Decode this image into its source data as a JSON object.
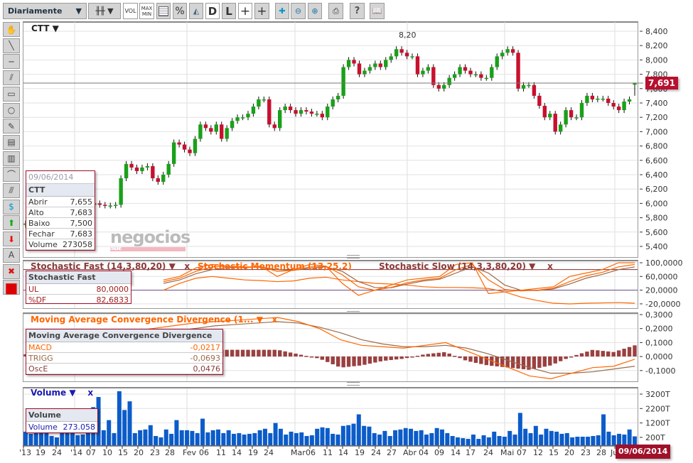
{
  "toolbar": {
    "period": "Diariamente",
    "vol": "VOL",
    "max": "MAX",
    "min": "MIN",
    "pct": "%",
    "d": "D",
    "l": "L",
    "help": "?"
  },
  "tools": [
    "hand-icon",
    "line-icon",
    "horizontal-line-icon",
    "channel-icon",
    "rectangle-icon",
    "circle-icon",
    "pencil-icon",
    "fibonacci-icon",
    "fibonacci-fan-icon",
    "arc-icon",
    "parallel-lines-icon",
    "dollar-lines-icon",
    "up-arrow-icon",
    "down-arrow-icon",
    "text-icon",
    "delete-icon",
    "color-icon"
  ],
  "text_tool": "A",
  "colors": {
    "up": "#1aa01a",
    "down": "#c8102e",
    "accent": "#a0102a",
    "orange": "#ff6600",
    "brown": "#9a6a4a",
    "volume": "#0b5cc9"
  },
  "main": {
    "symbol": "CTT",
    "high_label": "8,20",
    "last_price": "7,691",
    "watermark": "negocios",
    "watermark_sub": "ONLINE",
    "price_ticks": [
      "8,400",
      "8,200",
      "8,000",
      "7,800",
      "7,600",
      "7,400",
      "7,200",
      "7,000",
      "6,800",
      "6,600",
      "6,400",
      "6,200",
      "6,000",
      "5,800",
      "5,600",
      "5,400"
    ],
    "info": {
      "date": "09/06/2014",
      "symbol": "CTT",
      "rows": [
        {
          "k": "Abrir",
          "v": "7,655"
        },
        {
          "k": "Alto",
          "v": "7,683"
        },
        {
          "k": "Baixo",
          "v": "7,500"
        },
        {
          "k": "Fechar",
          "v": "7,683"
        },
        {
          "k": "Volume",
          "v": "273058"
        }
      ]
    }
  },
  "stoch": {
    "t1": "Stochastic Fast (14,3,80,20)",
    "t2": "Stochastic Momentum (13,25,2)",
    "t3": "Stochastic Slow (14,3,3,80,20)",
    "x": "x",
    "ticks": [
      "100,0000",
      "60,0000",
      "20,0000",
      "-20,0000"
    ],
    "info": {
      "title": "Stochastic Fast",
      "rows": [
        {
          "k": "UL",
          "v": "80,0000"
        },
        {
          "k": "%DF",
          "v": "82,6833"
        }
      ]
    }
  },
  "macd": {
    "title": "Moving Average Convergence Divergence (1...",
    "x": "x",
    "ticks": [
      "0,3000",
      "0,2000",
      "0,1000",
      "0,0000",
      "-0,1000"
    ],
    "info": {
      "title": "Moving Average Convergence Divergence",
      "rows": [
        {
          "k": "MACD",
          "v": "-0,0217"
        },
        {
          "k": "TRIGG",
          "v": "-0,0693"
        },
        {
          "k": "OscE",
          "v": "0,0476"
        }
      ]
    }
  },
  "volume": {
    "title": "Volume",
    "x": "x",
    "ticks": [
      "3200T",
      "2200T",
      "1200T",
      "200T"
    ],
    "info": {
      "title": "Volume",
      "k": "Volume",
      "v": "273.058"
    }
  },
  "dates": [
    "'13",
    "19",
    "24",
    "'14",
    "07",
    "10",
    "15",
    "20",
    "23",
    "28",
    "Fev",
    "06",
    "11",
    "14",
    "19",
    "24",
    "Mar",
    "06",
    "11",
    "14",
    "19",
    "24",
    "27",
    "Abr",
    "04",
    "09",
    "14",
    "17",
    "24",
    "Mai",
    "07",
    "12",
    "15",
    "20",
    "23",
    "28",
    "Jun"
  ],
  "current_date": "09/06/2014",
  "chart_data": {
    "type": "candlestick",
    "ylim": [
      5.4,
      8.4
    ],
    "close": [
      5.72,
      5.75,
      5.78,
      5.7,
      5.74,
      5.8,
      5.85,
      5.82,
      5.88,
      5.9,
      5.92,
      5.95,
      5.98,
      6.0,
      5.98,
      5.97,
      5.97,
      5.98,
      6.35,
      6.55,
      6.5,
      6.45,
      6.5,
      6.52,
      6.35,
      6.3,
      6.4,
      6.55,
      6.85,
      6.82,
      6.75,
      6.7,
      6.9,
      7.1,
      7.05,
      7.0,
      7.1,
      6.9,
      7.05,
      7.15,
      7.2,
      7.2,
      7.25,
      7.35,
      7.45,
      7.45,
      7.1,
      7.05,
      7.3,
      7.35,
      7.3,
      7.25,
      7.3,
      7.28,
      7.25,
      7.25,
      7.2,
      7.35,
      7.45,
      7.5,
      7.9,
      8.0,
      7.95,
      7.8,
      7.85,
      7.9,
      7.95,
      7.9,
      8.0,
      8.05,
      8.15,
      8.1,
      8.05,
      8.05,
      7.8,
      7.85,
      7.9,
      7.65,
      7.6,
      7.65,
      7.75,
      7.8,
      7.9,
      7.85,
      7.8,
      7.8,
      7.75,
      7.75,
      7.9,
      8.05,
      8.1,
      8.15,
      8.1,
      7.6,
      7.65,
      7.65,
      7.5,
      7.36,
      7.2,
      7.25,
      7.0,
      7.1,
      7.3,
      7.2,
      7.2,
      7.4,
      7.5,
      7.45,
      7.46,
      7.46,
      7.4,
      7.35,
      7.3,
      7.42,
      7.45,
      7.683
    ],
    "last_ohlc": [
      7.655,
      7.683,
      7.5,
      7.683
    ],
    "volume_T": [
      600,
      450,
      650,
      750,
      1000,
      300,
      200,
      900,
      550,
      1300,
      350,
      400,
      650,
      2300,
      3000,
      700,
      1400,
      500,
      3400,
      2100,
      2700,
      500,
      700,
      750,
      1050,
      300,
      200,
      750,
      450,
      1400,
      700,
      700,
      650,
      500,
      1500,
      550,
      700,
      750,
      500,
      700,
      450,
      500,
      400,
      450,
      500,
      700,
      800,
      500,
      1200,
      800,
      400,
      600,
      500,
      550,
      300,
      350,
      800,
      900,
      850,
      450,
      400,
      1000,
      1050,
      1150,
      1800,
      1000,
      950,
      500,
      400,
      650,
      300,
      700,
      750,
      850,
      800,
      650,
      700,
      400,
      500,
      850,
      750,
      500,
      300,
      200,
      150,
      100,
      400,
      100,
      350,
      200,
      600,
      300,
      250,
      650,
      400,
      1900,
      800,
      500,
      1000,
      400,
      800,
      650,
      600,
      450,
      500,
      200,
      250,
      250,
      250,
      300,
      350,
      1800,
      600,
      350,
      450,
      400,
      750,
      273
    ],
    "stoch_fast_k": [
      50,
      60,
      85,
      95,
      90,
      85,
      90,
      60,
      80,
      95,
      90,
      40,
      5,
      20,
      35,
      50,
      55,
      60,
      95,
      100,
      10,
      15,
      20,
      25,
      30,
      60,
      70,
      80,
      100,
      100
    ],
    "stoch_fast_d": [
      45,
      55,
      75,
      88,
      90,
      88,
      88,
      75,
      78,
      88,
      90,
      65,
      30,
      20,
      28,
      42,
      50,
      55,
      80,
      95,
      50,
      22,
      18,
      20,
      26,
      45,
      62,
      72,
      88,
      95
    ],
    "stoch_slow": [
      40,
      50,
      68,
      80,
      86,
      87,
      87,
      80,
      78,
      84,
      88,
      75,
      45,
      28,
      27,
      38,
      47,
      52,
      70,
      88,
      70,
      35,
      20,
      19,
      24,
      38,
      55,
      66,
      80,
      88
    ],
    "stoch_momentum": [
      20,
      40,
      55,
      60,
      55,
      50,
      48,
      45,
      47,
      55,
      58,
      50,
      45,
      40,
      38,
      35,
      30,
      28,
      28,
      27,
      25,
      15,
      0,
      -10,
      -18,
      -20,
      -18,
      -17,
      -16,
      -18
    ],
    "macd": [
      -0.05,
      0,
      0.05,
      0.1,
      0.15,
      0.18,
      0.2,
      0.22,
      0.24,
      0.25,
      0.26,
      0.27,
      0.28,
      0.25,
      0.2,
      0.12,
      0.08,
      0.07,
      0.06,
      0.08,
      0.1,
      0.04,
      -0.02,
      -0.08,
      -0.14,
      -0.16,
      -0.12,
      -0.08,
      -0.07,
      -0.02
    ],
    "trigger": [
      -0.06,
      -0.03,
      0.01,
      0.05,
      0.09,
      0.13,
      0.16,
      0.18,
      0.2,
      0.22,
      0.23,
      0.24,
      0.25,
      0.24,
      0.21,
      0.17,
      0.12,
      0.09,
      0.07,
      0.07,
      0.08,
      0.06,
      0.02,
      -0.03,
      -0.08,
      -0.12,
      -0.12,
      -0.11,
      -0.09,
      -0.07
    ]
  }
}
